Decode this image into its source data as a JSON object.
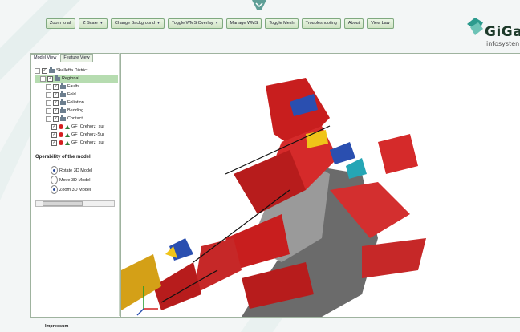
{
  "toolbar": {
    "buttons": [
      {
        "label": "Zoom to all",
        "dropdown": false
      },
      {
        "label": "Z Scale",
        "dropdown": true
      },
      {
        "label": "Change Background",
        "dropdown": true
      },
      {
        "label": "Toggle WMS Overlay",
        "dropdown": true
      },
      {
        "label": "Manage WMS",
        "dropdown": false
      },
      {
        "label": "Toggle Mesh",
        "dropdown": false
      },
      {
        "label": "Troubleshooting",
        "dropdown": false
      },
      {
        "label": "About",
        "dropdown": false
      },
      {
        "label": "View Law",
        "dropdown": false
      }
    ]
  },
  "logo": {
    "name": "GiGa",
    "sub": "infosysten"
  },
  "tabs": [
    {
      "label": "Model View",
      "active": true
    },
    {
      "label": "Feature View",
      "active": false
    }
  ],
  "tree": [
    {
      "label": "Skellefta District",
      "depth": 0,
      "type": "folder",
      "selected": false
    },
    {
      "label": "Regional",
      "depth": 1,
      "type": "folder",
      "selected": true
    },
    {
      "label": "Faults",
      "depth": 2,
      "type": "folder",
      "selected": false
    },
    {
      "label": "Fold",
      "depth": 2,
      "type": "folder",
      "selected": false
    },
    {
      "label": "Foliation",
      "depth": 2,
      "type": "folder",
      "selected": false
    },
    {
      "label": "Bedding",
      "depth": 2,
      "type": "folder",
      "selected": false
    },
    {
      "label": "Contact",
      "depth": 2,
      "type": "folder",
      "selected": false
    },
    {
      "label": "GF_Orehorz_sur",
      "depth": 3,
      "type": "surface",
      "selected": false
    },
    {
      "label": "GF_Orehorz-Sur",
      "depth": 3,
      "type": "surface",
      "selected": false
    },
    {
      "label": "GF_Orehorz_sur",
      "depth": 3,
      "type": "surface",
      "selected": false
    }
  ],
  "operability": {
    "title": "Operability of the model",
    "options": [
      {
        "label": "Rotate 3D Model",
        "checked": true
      },
      {
        "label": "Move 3D Model",
        "checked": false
      },
      {
        "label": "Zoom 3D Model",
        "checked": true
      }
    ]
  },
  "footer": {
    "label": "Impressum"
  },
  "colors": {
    "button_border": "#7fa97f",
    "selected_row": "#b6dcb0",
    "surface_red": "#d41f1f"
  }
}
